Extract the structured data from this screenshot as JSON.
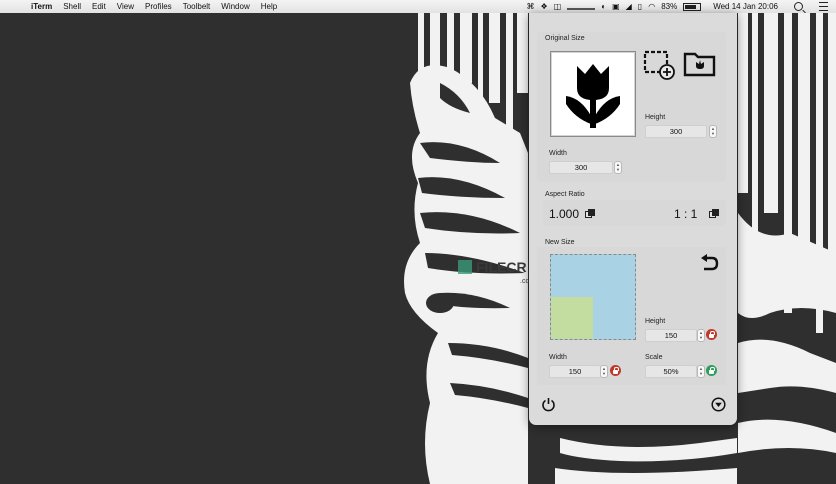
{
  "menubar": {
    "apple_symbol": "",
    "app_name": "iTerm",
    "menus": [
      "Shell",
      "Edit",
      "View",
      "Profiles",
      "Toolbelt",
      "Window",
      "Help"
    ],
    "battery": "83%",
    "datetime": "Wed 14 Jan  20:06",
    "icons": [
      "dropbox-icon",
      "volume-icon",
      "wifi-icon",
      "battery-icon",
      "search-icon",
      "notification-list-icon"
    ]
  },
  "panel": {
    "original": {
      "label": "Original Size",
      "height_label": "Height",
      "height_value": "300",
      "width_label": "Width",
      "width_value": "300"
    },
    "aspect": {
      "label": "Aspect Ratio",
      "decimal": "1.000",
      "ratio": "1 : 1"
    },
    "new_size": {
      "label": "New Size",
      "height_label": "Height",
      "height_value": "150",
      "width_label": "Width",
      "width_value": "150",
      "scale_label": "Scale",
      "scale_value": "50%",
      "scale_fraction": 0.5
    },
    "colors": {
      "lock_red": "#c0392b",
      "lock_green": "#2e9e5b",
      "preview_blue": "#a9d3e5",
      "preview_green": "#c3dca0"
    }
  },
  "watermark": {
    "main": "FILECR",
    "sub": ".com"
  }
}
